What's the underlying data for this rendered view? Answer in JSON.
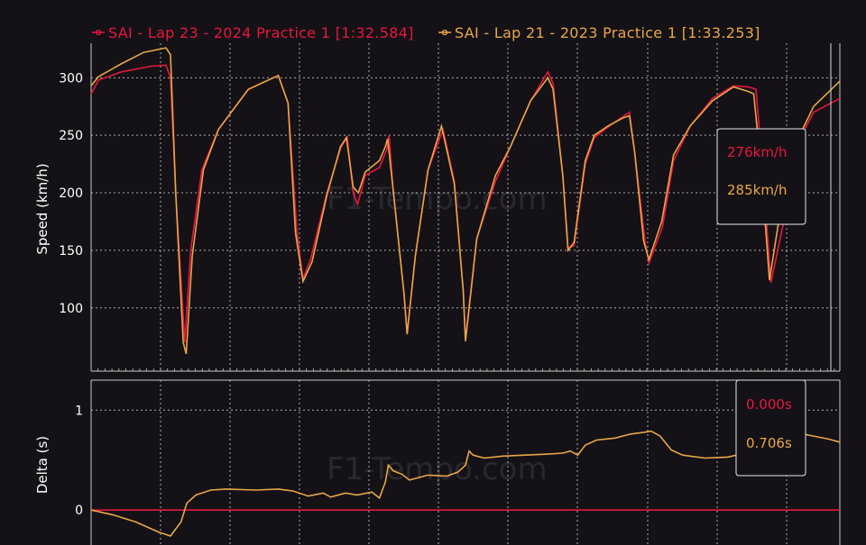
{
  "colors": {
    "lap_a": "#e8173f",
    "lap_b": "#e8a64a",
    "grid": "#c8c8c8",
    "background": "#141216"
  },
  "watermark": "F1-Tempo.com",
  "legend": [
    {
      "label": "SAI - Lap 23 - 2024 Practice 1 [1:32.584]",
      "color": "#e8173f"
    },
    {
      "label": "SAI - Lap 21 - 2023 Practice 1 [1:33.253]",
      "color": "#e8a64a"
    }
  ],
  "tooltip_speed": {
    "a": "276km/h",
    "b": "285km/h"
  },
  "tooltip_delta": {
    "a": "0.000s",
    "b": "0.706s"
  },
  "chart_data": [
    {
      "type": "line",
      "ylabel": "Speed (km/h)",
      "ylim": [
        45,
        330
      ],
      "yticks": [
        100,
        150,
        200,
        250,
        300
      ],
      "xlim": [
        0,
        1000
      ],
      "grid": true,
      "legend": "top",
      "series": [
        {
          "name": "SAI - Lap 23 - 2024 Practice 1 [1:32.584]",
          "color": "#e8173f",
          "points": [
            [
              0,
              286
            ],
            [
              10,
              298
            ],
            [
              40,
              305
            ],
            [
              80,
              310
            ],
            [
              100,
              311
            ],
            [
              106,
              300
            ],
            [
              113,
              200
            ],
            [
              125,
              70
            ],
            [
              133,
              150
            ],
            [
              148,
              220
            ],
            [
              170,
              255
            ],
            [
              210,
              290
            ],
            [
              250,
              302
            ],
            [
              263,
              278
            ],
            [
              275,
              165
            ],
            [
              283,
              125
            ],
            [
              293,
              142
            ],
            [
              315,
              200
            ],
            [
              334,
              240
            ],
            [
              342,
              248
            ],
            [
              350,
              200
            ],
            [
              356,
              190
            ],
            [
              366,
              215
            ],
            [
              385,
              222
            ],
            [
              395,
              238
            ],
            [
              398,
              250
            ],
            [
              403,
              205
            ],
            [
              418,
              112
            ],
            [
              422,
              78
            ],
            [
              433,
              145
            ],
            [
              450,
              220
            ],
            [
              470,
              255
            ],
            [
              485,
              210
            ],
            [
              497,
              115
            ],
            [
              500,
              74
            ],
            [
              515,
              160
            ],
            [
              540,
              210
            ],
            [
              560,
              240
            ],
            [
              587,
              280
            ],
            [
              610,
              305
            ],
            [
              617,
              295
            ],
            [
              630,
              215
            ],
            [
              637,
              152
            ],
            [
              645,
              154
            ],
            [
              660,
              225
            ],
            [
              672,
              248
            ],
            [
              690,
              257
            ],
            [
              710,
              266
            ],
            [
              719,
              270
            ],
            [
              726,
              235
            ],
            [
              740,
              157
            ],
            [
              745,
              139
            ],
            [
              763,
              170
            ],
            [
              778,
              228
            ],
            [
              800,
              258
            ],
            [
              830,
              282
            ],
            [
              858,
              293
            ],
            [
              878,
              292
            ],
            [
              888,
              290
            ],
            [
              897,
              220
            ],
            [
              908,
              122
            ],
            [
              925,
              175
            ],
            [
              945,
              245
            ],
            [
              965,
              270
            ],
            [
              1000,
              282
            ]
          ]
        },
        {
          "name": "SAI - Lap 21 - 2023 Practice 1 [1:33.253]",
          "color": "#e8a64a",
          "points": [
            [
              0,
              293
            ],
            [
              10,
              301
            ],
            [
              40,
              312
            ],
            [
              70,
              322
            ],
            [
              100,
              326
            ],
            [
              106,
              320
            ],
            [
              113,
              200
            ],
            [
              123,
              70
            ],
            [
              127,
              60
            ],
            [
              135,
              145
            ],
            [
              150,
              220
            ],
            [
              170,
              255
            ],
            [
              210,
              290
            ],
            [
              250,
              302
            ],
            [
              263,
              278
            ],
            [
              273,
              165
            ],
            [
              283,
              123
            ],
            [
              295,
              140
            ],
            [
              315,
              198
            ],
            [
              333,
              240
            ],
            [
              341,
              248
            ],
            [
              350,
              205
            ],
            [
              357,
              200
            ],
            [
              366,
              218
            ],
            [
              385,
              228
            ],
            [
              393,
              240
            ],
            [
              396,
              247
            ],
            [
              403,
              205
            ],
            [
              418,
              112
            ],
            [
              422,
              77
            ],
            [
              433,
              145
            ],
            [
              450,
              220
            ],
            [
              468,
              258
            ],
            [
              485,
              208
            ],
            [
              497,
              115
            ],
            [
              500,
              71
            ],
            [
              515,
              160
            ],
            [
              540,
              215
            ],
            [
              560,
              240
            ],
            [
              587,
              280
            ],
            [
              610,
              300
            ],
            [
              617,
              290
            ],
            [
              630,
              215
            ],
            [
              637,
              150
            ],
            [
              645,
              157
            ],
            [
              660,
              228
            ],
            [
              672,
              250
            ],
            [
              690,
              258
            ],
            [
              710,
              265
            ],
            [
              719,
              267
            ],
            [
              726,
              235
            ],
            [
              738,
              158
            ],
            [
              745,
              142
            ],
            [
              762,
              175
            ],
            [
              778,
              233
            ],
            [
              800,
              258
            ],
            [
              830,
              280
            ],
            [
              858,
              292
            ],
            [
              878,
              288
            ],
            [
              885,
              286
            ],
            [
              895,
              220
            ],
            [
              906,
              124
            ],
            [
              920,
              182
            ],
            [
              945,
              248
            ],
            [
              965,
              275
            ],
            [
              1000,
              297
            ]
          ]
        }
      ]
    },
    {
      "type": "line",
      "ylabel": "Delta (s)",
      "ylim": [
        -0.35,
        1.3
      ],
      "yticks": [
        0,
        1
      ],
      "xlim": [
        0,
        1000
      ],
      "grid": true,
      "series": [
        {
          "name": "SAI - Lap 23 - 2024 Practice 1 [1:32.584]",
          "color": "#e8173f",
          "points": [
            [
              0,
              0
            ],
            [
              1000,
              0
            ]
          ]
        },
        {
          "name": "SAI - Lap 21 - 2023 Practice 1 [1:33.253]",
          "color": "#e8a64a",
          "points": [
            [
              0,
              0
            ],
            [
              30,
              -0.05
            ],
            [
              60,
              -0.12
            ],
            [
              90,
              -0.22
            ],
            [
              106,
              -0.26
            ],
            [
              120,
              -0.12
            ],
            [
              128,
              0.07
            ],
            [
              140,
              0.15
            ],
            [
              160,
              0.2
            ],
            [
              180,
              0.21
            ],
            [
              220,
              0.2
            ],
            [
              250,
              0.21
            ],
            [
              270,
              0.19
            ],
            [
              290,
              0.14
            ],
            [
              310,
              0.17
            ],
            [
              320,
              0.13
            ],
            [
              340,
              0.17
            ],
            [
              355,
              0.15
            ],
            [
              375,
              0.18
            ],
            [
              385,
              0.12
            ],
            [
              393,
              0.28
            ],
            [
              397,
              0.45
            ],
            [
              404,
              0.39
            ],
            [
              415,
              0.36
            ],
            [
              425,
              0.3
            ],
            [
              450,
              0.35
            ],
            [
              475,
              0.34
            ],
            [
              490,
              0.38
            ],
            [
              500,
              0.45
            ],
            [
              505,
              0.59
            ],
            [
              510,
              0.55
            ],
            [
              525,
              0.52
            ],
            [
              550,
              0.54
            ],
            [
              580,
              0.55
            ],
            [
              610,
              0.56
            ],
            [
              630,
              0.57
            ],
            [
              640,
              0.59
            ],
            [
              650,
              0.55
            ],
            [
              660,
              0.65
            ],
            [
              675,
              0.7
            ],
            [
              700,
              0.72
            ],
            [
              720,
              0.76
            ],
            [
              740,
              0.78
            ],
            [
              748,
              0.79
            ],
            [
              760,
              0.74
            ],
            [
              775,
              0.6
            ],
            [
              790,
              0.55
            ],
            [
              820,
              0.52
            ],
            [
              850,
              0.53
            ],
            [
              880,
              0.58
            ],
            [
              895,
              0.69
            ],
            [
              910,
              0.73
            ],
            [
              925,
              0.76
            ],
            [
              945,
              0.77
            ],
            [
              965,
              0.74
            ],
            [
              985,
              0.71
            ],
            [
              1000,
              0.68
            ]
          ]
        }
      ]
    }
  ]
}
